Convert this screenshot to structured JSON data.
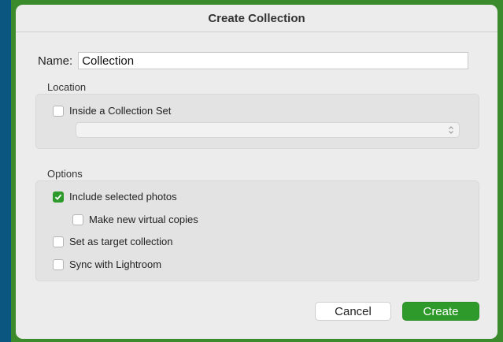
{
  "dialog": {
    "title": "Create Collection",
    "name_label": "Name:",
    "name_value": "Collection"
  },
  "location": {
    "label": "Location",
    "inside_set": {
      "label": "Inside a Collection Set",
      "checked": false
    },
    "set_select_value": ""
  },
  "options": {
    "label": "Options",
    "include_selected": {
      "label": "Include selected photos",
      "checked": true
    },
    "virtual_copies": {
      "label": "Make new virtual copies",
      "checked": false
    },
    "target_collection": {
      "label": "Set as target collection",
      "checked": false
    },
    "sync_lightroom": {
      "label": "Sync with Lightroom",
      "checked": false
    }
  },
  "buttons": {
    "cancel": "Cancel",
    "create": "Create"
  },
  "colors": {
    "accent": "#2f9a2c",
    "frame_green": "#3b8a2c",
    "background_blue": "#0b5680"
  }
}
